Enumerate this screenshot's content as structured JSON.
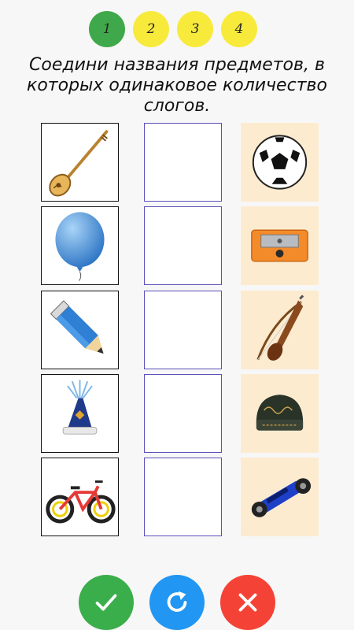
{
  "steps": [
    {
      "label": "1",
      "color": "#3fa84a"
    },
    {
      "label": "2",
      "color": "#f8ea3b"
    },
    {
      "label": "3",
      "color": "#f8ea3b"
    },
    {
      "label": "4",
      "color": "#f8ea3b"
    }
  ],
  "instruction": "Соедини названия предметов, в которых одинаковое количество слогов.",
  "left_items": [
    "dombra-icon",
    "balloon-icon",
    "pencil-icon",
    "hat-icon",
    "bicycle-icon"
  ],
  "right_items": [
    "soccer-ball-icon",
    "pencil-sharpener-icon",
    "kobyz-icon",
    "skullcap-icon",
    "hoverboard-icon"
  ],
  "right_bg": "#fdebd0",
  "buttons": [
    {
      "name": "check-button",
      "color": "#3aae4a"
    },
    {
      "name": "refresh-button",
      "color": "#2196f3"
    },
    {
      "name": "close-button",
      "color": "#f44336"
    }
  ]
}
